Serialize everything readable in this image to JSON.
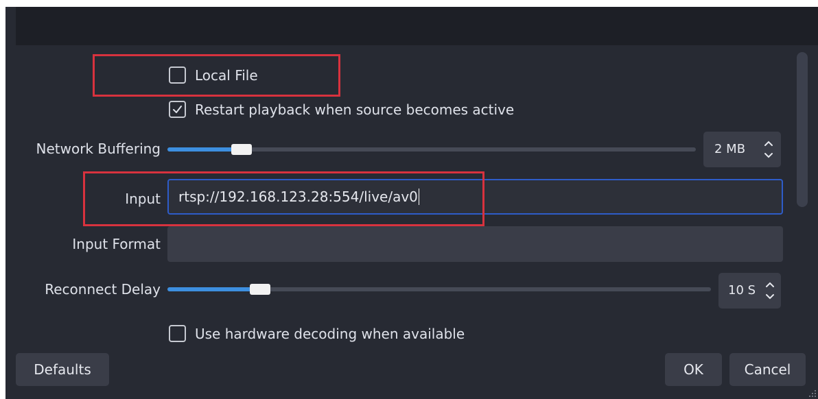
{
  "options": {
    "local_file": {
      "label": "Local File",
      "checked": false
    },
    "restart_playback": {
      "label": "Restart playback when source becomes active",
      "checked": true
    },
    "hardware_decoding": {
      "label": "Use hardware decoding when available",
      "checked": false
    }
  },
  "network_buffering": {
    "label": "Network Buffering",
    "value_text": "2 MB",
    "level": 0.14
  },
  "input": {
    "label": "Input",
    "value": "rtsp://192.168.123.28:554/live/av0"
  },
  "input_format": {
    "label": "Input Format",
    "value": ""
  },
  "reconnect_delay": {
    "label": "Reconnect Delay",
    "value_text": "10 S",
    "level": 0.17
  },
  "buttons": {
    "defaults": "Defaults",
    "ok": "OK",
    "cancel": "Cancel"
  },
  "colors": {
    "background": "#272a33",
    "accent": "#3d8fe0",
    "focus_border": "#2e5cc9",
    "annotation_red": "#d8323e"
  },
  "icons": {
    "check": "checkmark-icon",
    "spin_up": "chevron-up-icon",
    "spin_down": "chevron-down-icon"
  }
}
